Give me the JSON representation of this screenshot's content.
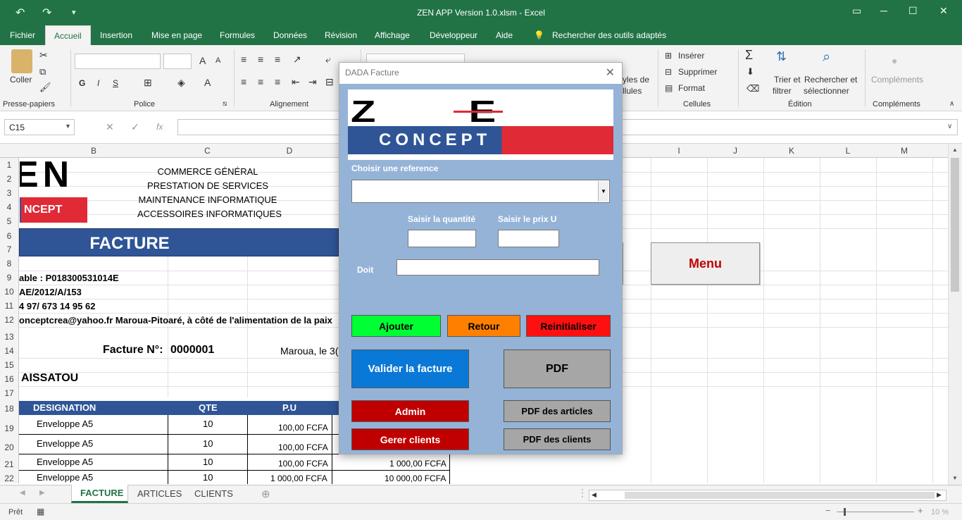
{
  "window": {
    "title": "ZEN APP Version 1.0.xlsm  -  Excel"
  },
  "ribbon": {
    "tabs": [
      "Fichier",
      "Accueil",
      "Insertion",
      "Mise en page",
      "Formules",
      "Données",
      "Révision",
      "Affichage",
      "Développeur",
      "Aide"
    ],
    "active_tab": "Accueil",
    "search_label": "Rechercher des outils adaptés",
    "paste_label": "Coller",
    "groups": [
      "Presse-papiers",
      "Police",
      "Alignement",
      "Cellules",
      "Édition",
      "Compléments"
    ],
    "cells_buttons": [
      "Insérer",
      "Supprimer",
      "Format"
    ],
    "styles_label1": "yles de",
    "styles_label2": "llules",
    "sort_label1": "Trier et",
    "sort_label2": "filtrer",
    "find_label1": "Rechercher et",
    "find_label2": "sélectionner",
    "addins_label": "Compléments",
    "bold": "G",
    "italic": "I",
    "underline": "S"
  },
  "formula_bar": {
    "name_box": "C15",
    "fx": "fx",
    "value": ""
  },
  "columns": [
    "B",
    "C",
    "D",
    "I",
    "J",
    "K",
    "L",
    "M"
  ],
  "rows": [
    "1",
    "2",
    "3",
    "4",
    "5",
    "6",
    "7",
    "8",
    "9",
    "10",
    "11",
    "12",
    "13",
    "14",
    "15",
    "16",
    "17",
    "18",
    "19",
    "20",
    "21",
    "22"
  ],
  "sheet": {
    "logo_top": "EN",
    "logo_bottom": "NCEPT",
    "company_lines": [
      "COMMERCE GÉNÉRAL",
      "PRESTATION DE SERVICES",
      "MAINTENANCE INFORMATIQUE",
      "ACCESSOIRES INFORMATIQUES"
    ],
    "banner": "FACTURE",
    "info_lines": [
      "able : P018300531014E",
      "AE/2012/A/153",
      "4 97/ 673 14 95 62",
      "onceptcrea@yahoo.fr  Maroua-Pitoaré, à côté de l'alimentation de la paix"
    ],
    "invoice_label": "Facture N°:",
    "invoice_number": "0000001",
    "location_date": "Maroua, le 3(",
    "client": "AISSATOU",
    "table_headers": [
      "DESIGNATION",
      "QTE",
      "P.U"
    ],
    "table_rows": [
      {
        "designation": "Enveloppe A5",
        "qte": "10",
        "pu": "100,00 FCFA",
        "total": ""
      },
      {
        "designation": "Enveloppe A5",
        "qte": "10",
        "pu": "100,00 FCFA",
        "total": ""
      },
      {
        "designation": "Enveloppe A5",
        "qte": "10",
        "pu": "100,00 FCFA",
        "total": "1 000,00 FCFA"
      },
      {
        "designation": "Enveloppe A5",
        "qte": "10",
        "pu": "1 000,00 FCFA",
        "total": "10 000,00 FCFA"
      }
    ],
    "menu_button": "Menu"
  },
  "sheet_tabs": [
    "FACTURE",
    "ARTICLES",
    "CLIENTS"
  ],
  "active_sheet": "FACTURE",
  "status": {
    "ready": "Prêt",
    "zoom": "10 %"
  },
  "dialog": {
    "title": "DADA Facture",
    "logo_zen": "Z E N",
    "logo_concept": "CONCEPT",
    "choose_ref_label": "Choisir une reference",
    "qty_label": "Saisir la quantité",
    "price_label": "Saisir le prix U",
    "doit_label": "Doit",
    "buttons": {
      "ajouter": "Ajouter",
      "retour": "Retour",
      "reinitialiser": "Reinitialiser",
      "valider": "Valider la facture",
      "pdf": "PDF",
      "admin": "Admin",
      "pdf_articles": "PDF des articles",
      "gerer_clients": "Gerer clients",
      "pdf_clients": "PDF des clients"
    }
  },
  "colors": {
    "excel_green": "#217346",
    "banner_blue": "#2f5597",
    "dialog_bg": "#95b3d7",
    "btn_green": "#00ff33",
    "btn_orange": "#ff8000",
    "btn_red": "#ff1010",
    "btn_blue": "#0a78d7",
    "btn_darkred": "#c00000",
    "btn_gray": "#a6a6a6",
    "menu_red": "#c00000"
  }
}
